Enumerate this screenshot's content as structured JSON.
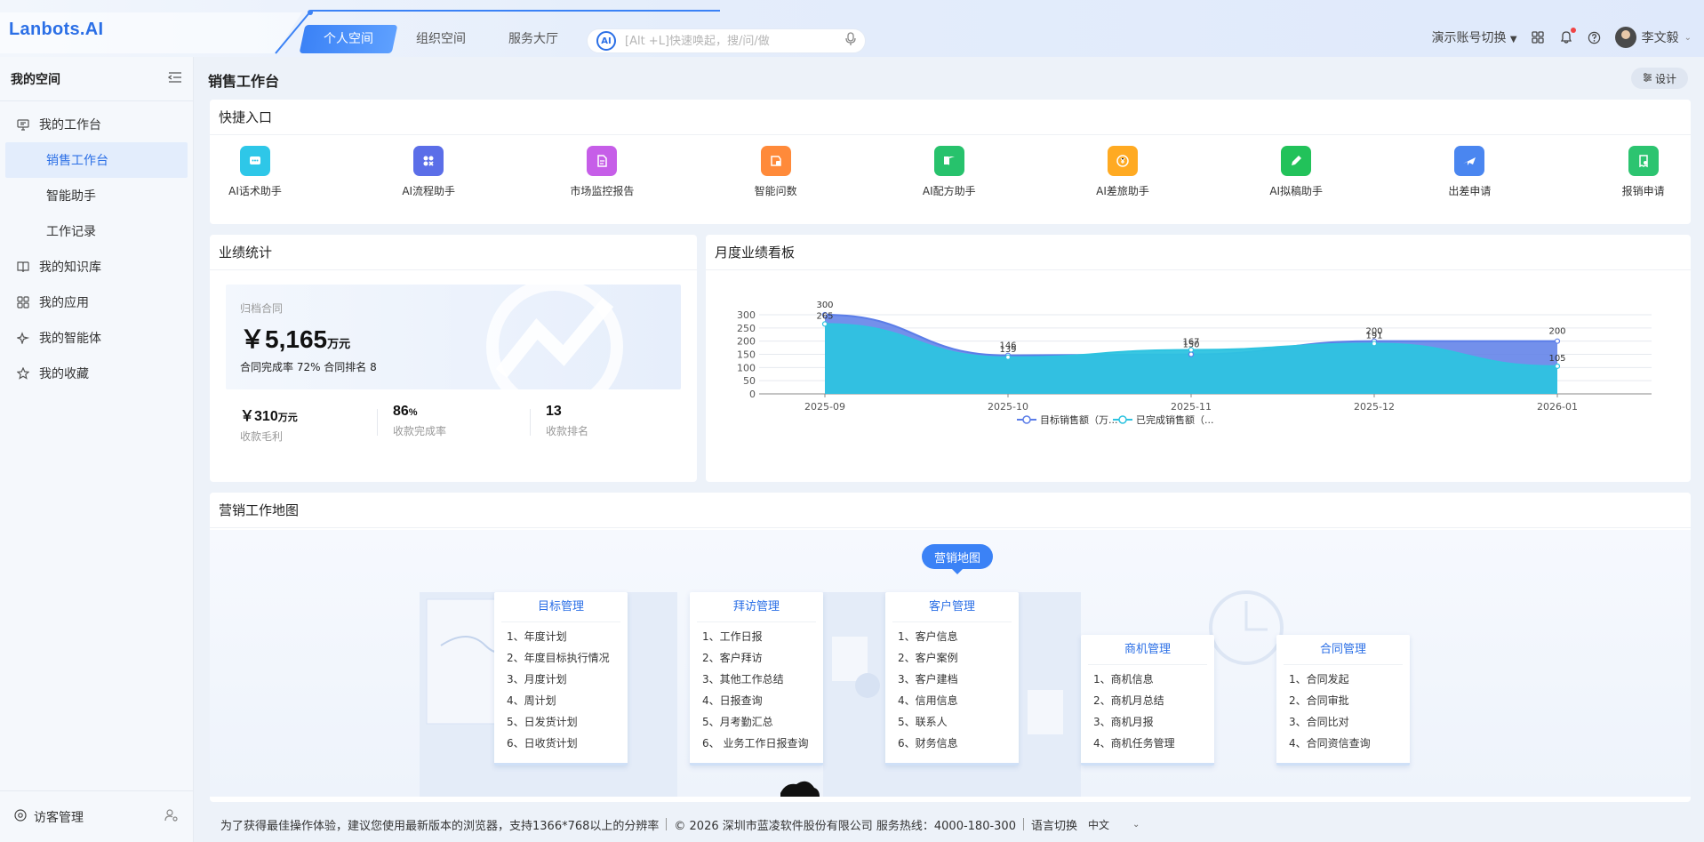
{
  "app": {
    "logo": "Lanbots.AI"
  },
  "header": {
    "tabs": [
      {
        "label": "个人空间",
        "active": true
      },
      {
        "label": "组织空间",
        "active": false
      },
      {
        "label": "服务大厅",
        "active": false
      }
    ],
    "ai_badge": "AI",
    "search_placeholder": "[Alt +L]快速唤起，搜/问/做",
    "account_switch": "演示账号切换",
    "user_name": "李文毅"
  },
  "sidebar": {
    "title": "我的空间",
    "items": [
      {
        "label": "我的工作台",
        "icon": "monitor-icon"
      },
      {
        "label": "销售工作台",
        "sub": true,
        "active": true
      },
      {
        "label": "智能助手",
        "sub": true
      },
      {
        "label": "工作记录",
        "sub": true
      },
      {
        "label": "我的知识库",
        "icon": "book-icon"
      },
      {
        "label": "我的应用",
        "icon": "grid-icon"
      },
      {
        "label": "我的智能体",
        "icon": "sparkle-icon"
      },
      {
        "label": "我的收藏",
        "icon": "star-icon"
      }
    ],
    "footer_label": "访客管理"
  },
  "page": {
    "title": "销售工作台",
    "design_label": "设计"
  },
  "quick_entry": {
    "title": "快捷入口",
    "items": [
      {
        "label": "AI话术助手",
        "color": "#2ec7e8",
        "icon": "chat-icon"
      },
      {
        "label": "AI流程助手",
        "color": "#5b6ee8",
        "icon": "flow-icon"
      },
      {
        "label": "市场监控报告",
        "color": "#c65ee8",
        "icon": "report-icon"
      },
      {
        "label": "智能问数",
        "color": "#ff8a3a",
        "icon": "data-icon"
      },
      {
        "label": "AI配方助手",
        "color": "#27c26c",
        "icon": "book-open-icon"
      },
      {
        "label": "AI差旅助手",
        "color": "#ffaa22",
        "icon": "coin-icon"
      },
      {
        "label": "AI拟稿助手",
        "color": "#22c25a",
        "icon": "pencil-icon"
      },
      {
        "label": "出差申请",
        "color": "#4a86f0",
        "icon": "plane-icon"
      },
      {
        "label": "报销申请",
        "color": "#2cc470",
        "icon": "receipt-icon"
      }
    ]
  },
  "performance": {
    "title": "业绩统计",
    "archive_label": "归档合同",
    "archive_currency": "￥",
    "archive_value": "5,165",
    "archive_unit": "万元",
    "archive_sub": "合同完成率 72% 合同排名 8",
    "stats": [
      {
        "prefix": "￥",
        "value": "310",
        "unit": "万元",
        "label": "收款毛利"
      },
      {
        "prefix": "",
        "value": "86",
        "unit": "%",
        "label": "收款完成率"
      },
      {
        "prefix": "",
        "value": "13",
        "unit": "",
        "label": "收款排名"
      }
    ]
  },
  "monthly": {
    "title": "月度业绩看板"
  },
  "chart_data": {
    "type": "area",
    "x": [
      "2025-09",
      "2025-10",
      "2025-11",
      "2025-12",
      "2026-01"
    ],
    "ylim": [
      0,
      300
    ],
    "yticks": [
      0,
      50,
      100,
      150,
      200,
      250,
      300
    ],
    "grid": true,
    "legend_position": "bottom",
    "series": [
      {
        "name": "目标销售额（万...",
        "values": [
          300,
          146,
          150,
          200,
          200
        ],
        "color": "#5b7de8"
      },
      {
        "name": "已完成销售额（...",
        "values": [
          265,
          139,
          167,
          191,
          105
        ],
        "color": "#2ec3e0"
      }
    ]
  },
  "marketing_map": {
    "title": "营销工作地图",
    "pill": "营销地图",
    "cards": [
      {
        "title": "目标管理",
        "items": [
          "1、年度计划",
          "2、年度目标执行情况",
          "3、月度计划",
          "4、周计划",
          "5、日发货计划",
          "6、日收货计划"
        ]
      },
      {
        "title": "拜访管理",
        "items": [
          "1、工作日报",
          "2、客户拜访",
          "3、其他工作总结",
          "4、日报查询",
          "5、月考勤汇总",
          "6、 业务工作日报查询"
        ]
      },
      {
        "title": "客户管理",
        "items": [
          "1、客户信息",
          "2、客户案例",
          "3、客户建档",
          "4、信用信息",
          "5、联系人",
          "6、财务信息"
        ]
      },
      {
        "title": "商机管理",
        "items": [
          "1、商机信息",
          "2、商机月总结",
          "3、商机月报",
          "4、商机任务管理"
        ]
      },
      {
        "title": "合同管理",
        "items": [
          "1、合同发起",
          "2、合同审批",
          "3、合同比对",
          "4、合同资信查询"
        ]
      }
    ]
  },
  "footer": {
    "browser_tip": "为了获得最佳操作体验，建议您使用最新版本的浏览器，支持1366*768以上的分辨率",
    "copyright": "© 2026 深圳市蓝凌软件股份有限公司 服务热线：4000-180-300",
    "lang_label": "语言切换",
    "lang_value": "中文"
  }
}
